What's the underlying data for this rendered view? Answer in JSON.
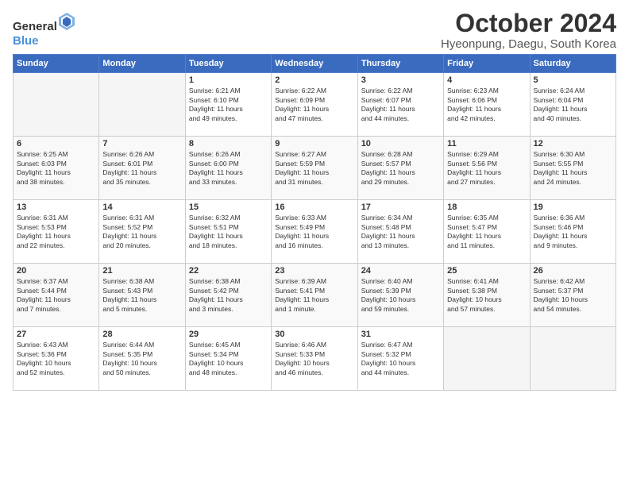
{
  "header": {
    "logo_general": "General",
    "logo_blue": "Blue",
    "title": "October 2024",
    "location": "Hyeonpung, Daegu, South Korea"
  },
  "weekdays": [
    "Sunday",
    "Monday",
    "Tuesday",
    "Wednesday",
    "Thursday",
    "Friday",
    "Saturday"
  ],
  "weeks": [
    [
      {
        "day": "",
        "info": ""
      },
      {
        "day": "",
        "info": ""
      },
      {
        "day": "1",
        "info": "Sunrise: 6:21 AM\nSunset: 6:10 PM\nDaylight: 11 hours\nand 49 minutes."
      },
      {
        "day": "2",
        "info": "Sunrise: 6:22 AM\nSunset: 6:09 PM\nDaylight: 11 hours\nand 47 minutes."
      },
      {
        "day": "3",
        "info": "Sunrise: 6:22 AM\nSunset: 6:07 PM\nDaylight: 11 hours\nand 44 minutes."
      },
      {
        "day": "4",
        "info": "Sunrise: 6:23 AM\nSunset: 6:06 PM\nDaylight: 11 hours\nand 42 minutes."
      },
      {
        "day": "5",
        "info": "Sunrise: 6:24 AM\nSunset: 6:04 PM\nDaylight: 11 hours\nand 40 minutes."
      }
    ],
    [
      {
        "day": "6",
        "info": "Sunrise: 6:25 AM\nSunset: 6:03 PM\nDaylight: 11 hours\nand 38 minutes."
      },
      {
        "day": "7",
        "info": "Sunrise: 6:26 AM\nSunset: 6:01 PM\nDaylight: 11 hours\nand 35 minutes."
      },
      {
        "day": "8",
        "info": "Sunrise: 6:26 AM\nSunset: 6:00 PM\nDaylight: 11 hours\nand 33 minutes."
      },
      {
        "day": "9",
        "info": "Sunrise: 6:27 AM\nSunset: 5:59 PM\nDaylight: 11 hours\nand 31 minutes."
      },
      {
        "day": "10",
        "info": "Sunrise: 6:28 AM\nSunset: 5:57 PM\nDaylight: 11 hours\nand 29 minutes."
      },
      {
        "day": "11",
        "info": "Sunrise: 6:29 AM\nSunset: 5:56 PM\nDaylight: 11 hours\nand 27 minutes."
      },
      {
        "day": "12",
        "info": "Sunrise: 6:30 AM\nSunset: 5:55 PM\nDaylight: 11 hours\nand 24 minutes."
      }
    ],
    [
      {
        "day": "13",
        "info": "Sunrise: 6:31 AM\nSunset: 5:53 PM\nDaylight: 11 hours\nand 22 minutes."
      },
      {
        "day": "14",
        "info": "Sunrise: 6:31 AM\nSunset: 5:52 PM\nDaylight: 11 hours\nand 20 minutes."
      },
      {
        "day": "15",
        "info": "Sunrise: 6:32 AM\nSunset: 5:51 PM\nDaylight: 11 hours\nand 18 minutes."
      },
      {
        "day": "16",
        "info": "Sunrise: 6:33 AM\nSunset: 5:49 PM\nDaylight: 11 hours\nand 16 minutes."
      },
      {
        "day": "17",
        "info": "Sunrise: 6:34 AM\nSunset: 5:48 PM\nDaylight: 11 hours\nand 13 minutes."
      },
      {
        "day": "18",
        "info": "Sunrise: 6:35 AM\nSunset: 5:47 PM\nDaylight: 11 hours\nand 11 minutes."
      },
      {
        "day": "19",
        "info": "Sunrise: 6:36 AM\nSunset: 5:46 PM\nDaylight: 11 hours\nand 9 minutes."
      }
    ],
    [
      {
        "day": "20",
        "info": "Sunrise: 6:37 AM\nSunset: 5:44 PM\nDaylight: 11 hours\nand 7 minutes."
      },
      {
        "day": "21",
        "info": "Sunrise: 6:38 AM\nSunset: 5:43 PM\nDaylight: 11 hours\nand 5 minutes."
      },
      {
        "day": "22",
        "info": "Sunrise: 6:38 AM\nSunset: 5:42 PM\nDaylight: 11 hours\nand 3 minutes."
      },
      {
        "day": "23",
        "info": "Sunrise: 6:39 AM\nSunset: 5:41 PM\nDaylight: 11 hours\nand 1 minute."
      },
      {
        "day": "24",
        "info": "Sunrise: 6:40 AM\nSunset: 5:39 PM\nDaylight: 10 hours\nand 59 minutes."
      },
      {
        "day": "25",
        "info": "Sunrise: 6:41 AM\nSunset: 5:38 PM\nDaylight: 10 hours\nand 57 minutes."
      },
      {
        "day": "26",
        "info": "Sunrise: 6:42 AM\nSunset: 5:37 PM\nDaylight: 10 hours\nand 54 minutes."
      }
    ],
    [
      {
        "day": "27",
        "info": "Sunrise: 6:43 AM\nSunset: 5:36 PM\nDaylight: 10 hours\nand 52 minutes."
      },
      {
        "day": "28",
        "info": "Sunrise: 6:44 AM\nSunset: 5:35 PM\nDaylight: 10 hours\nand 50 minutes."
      },
      {
        "day": "29",
        "info": "Sunrise: 6:45 AM\nSunset: 5:34 PM\nDaylight: 10 hours\nand 48 minutes."
      },
      {
        "day": "30",
        "info": "Sunrise: 6:46 AM\nSunset: 5:33 PM\nDaylight: 10 hours\nand 46 minutes."
      },
      {
        "day": "31",
        "info": "Sunrise: 6:47 AM\nSunset: 5:32 PM\nDaylight: 10 hours\nand 44 minutes."
      },
      {
        "day": "",
        "info": ""
      },
      {
        "day": "",
        "info": ""
      }
    ]
  ]
}
